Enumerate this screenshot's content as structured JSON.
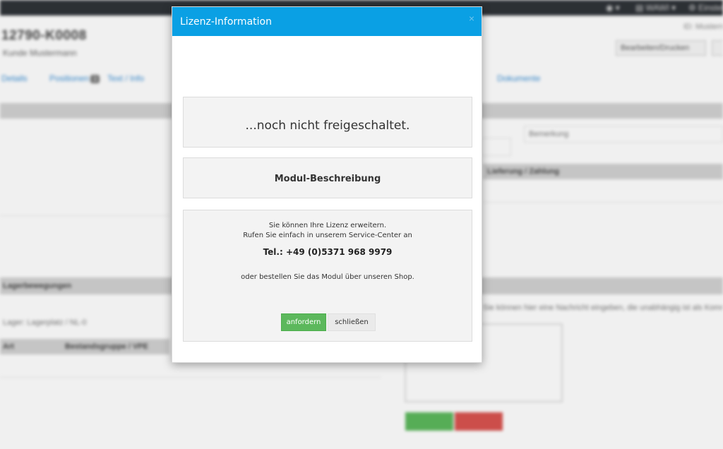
{
  "background": {
    "topbar": {
      "globe_label": "◉ ▾",
      "wawi_label": "▤ WAWI ▾",
      "settings_label": "⚙ Einstell"
    },
    "order": {
      "number": "12790-K0008",
      "subtitle": "Kunde Mustermann",
      "top_right": "ID: Mustern"
    },
    "buttons": {
      "edit_label": "Bearbeiten/Drucken"
    },
    "tabs": [
      {
        "label": "Details"
      },
      {
        "label": "Positionen",
        "count": "3"
      },
      {
        "label": "Text / Info"
      },
      {
        "label": "Dokumente"
      }
    ],
    "sections": {
      "right_field": "Bemerkung",
      "right_bar_title": "Lieferung / Zahlung",
      "bottom_left_bar": "Lagerbewegungen",
      "lager_label": "Lager: Lagerplatz / NL-0",
      "table_headers": [
        "Art",
        "Bestandsgruppe / VPE"
      ],
      "hint_text": "Sie können hier eine Nachricht eingeben, die unabhängig ist als Kommentar"
    }
  },
  "modal": {
    "title": "Lizenz-Information",
    "close_icon": "×",
    "status_text": "...noch nicht freigeschaltet.",
    "module_title": "Modul-Beschreibung",
    "info_line1": "Sie können Ihre Lizenz erweitern.",
    "info_line2": "Rufen Sie einfach in unserem Service-Center an",
    "phone": "Tel.: +49 (0)5371 968 9979",
    "shop_text": "oder bestellen Sie das Modul über unseren Shop.",
    "request_button": "anfordern",
    "close_button": "schließen"
  },
  "colors": {
    "header_blue": "#0aa0e4",
    "success_green": "#5cb85c",
    "danger_red": "#d9534f",
    "topbar_dark": "#2f3338"
  }
}
